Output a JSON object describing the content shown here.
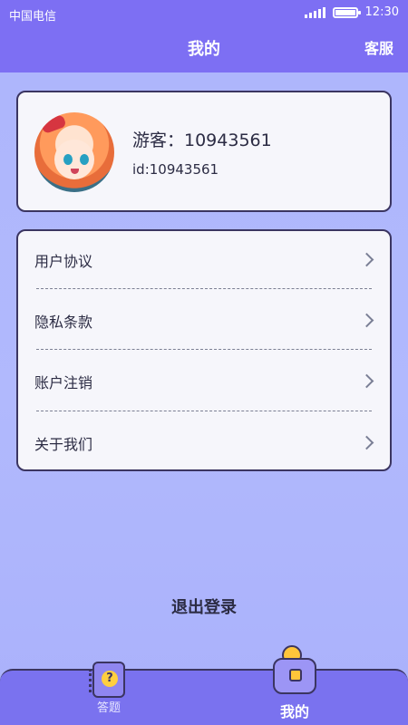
{
  "status_bar": {
    "carrier": "中国电信",
    "time": "12:30"
  },
  "header": {
    "title": "我的",
    "service_label": "客服"
  },
  "profile": {
    "name": "游客：10943561",
    "id_text": "id:10943561",
    "avatar_icon": "anime-avatar"
  },
  "menu": {
    "items": [
      {
        "label": "用户协议"
      },
      {
        "label": "隐私条款"
      },
      {
        "label": "账户注销"
      },
      {
        "label": "关于我们"
      }
    ]
  },
  "logout_label": "退出登录",
  "tabbar": {
    "tabs": [
      {
        "label": "答题",
        "icon": "quiz-notebook-icon",
        "active": false
      },
      {
        "label": "我的",
        "icon": "wallet-icon",
        "active": true
      }
    ]
  },
  "colors": {
    "header": "#7d6ff3",
    "background": "#a9b1fb",
    "card_border": "#3b3561",
    "tabbar": "#7a72ef"
  }
}
